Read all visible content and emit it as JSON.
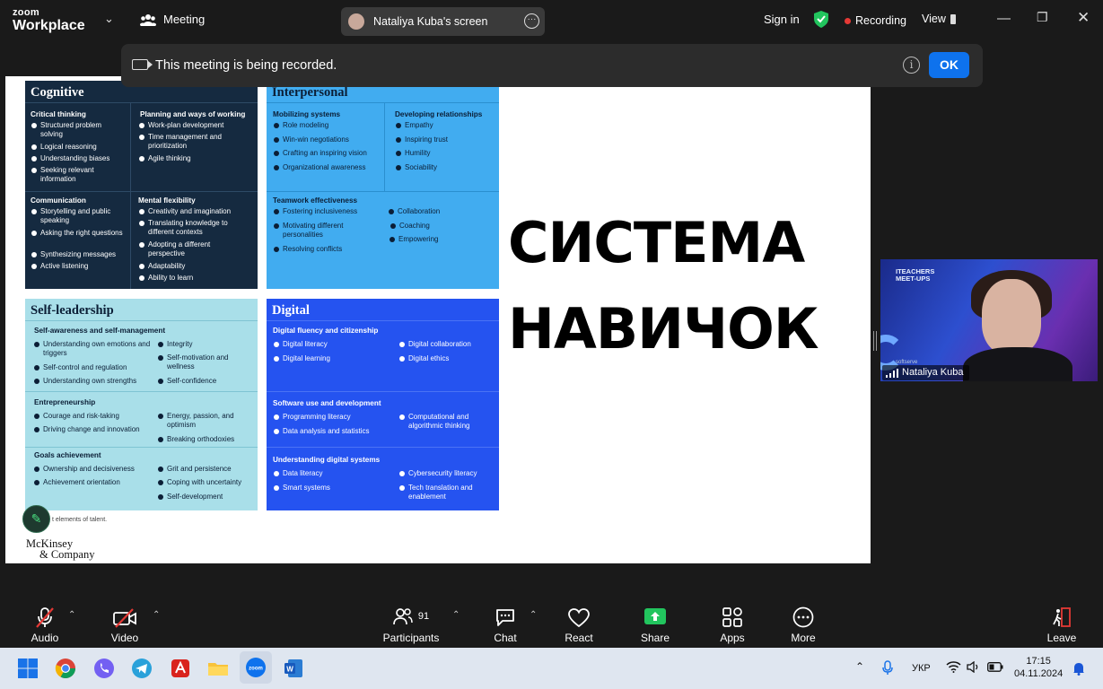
{
  "topbar": {
    "logo_line1": "zoom",
    "logo_line2": "Workplace",
    "meeting_label": "Meeting",
    "share_pill": "Nataliya Kuba's screen",
    "sign_in": "Sign in",
    "recording": "Recording",
    "view": "View"
  },
  "notice": {
    "text": "This meeting is being recorded.",
    "ok": "OK"
  },
  "slide": {
    "cognitive": {
      "title": "Cognitive",
      "critical_thinking": {
        "title": "Critical thinking",
        "items": [
          "Structured problem solving",
          "Logical reasoning",
          "Understanding biases",
          "Seeking relevant information"
        ]
      },
      "planning": {
        "title": "Planning and ways of working",
        "items": [
          "Work-plan development",
          "Time management and prioritization",
          "Agile thinking"
        ]
      },
      "communication": {
        "title": "Communication",
        "items": [
          "Storytelling and public speaking",
          "Asking the right questions",
          "Synthesizing messages",
          "Active listening"
        ]
      },
      "mental_flexibility": {
        "title": "Mental flexibility",
        "items": [
          "Creativity and imagination",
          "Translating knowledge to different contexts",
          "Adopting a different perspective",
          "Adaptability",
          "Ability to learn"
        ]
      }
    },
    "interpersonal": {
      "title": "Interpersonal",
      "mobilizing": {
        "title": "Mobilizing systems",
        "items": [
          "Role modeling",
          "Win-win negotiations",
          "Crafting an inspiring vision",
          "Organizational awareness"
        ]
      },
      "developing": {
        "title": "Developing relationships",
        "items": [
          "Empathy",
          "Inspiring trust",
          "Humility",
          "Sociability"
        ]
      },
      "teamwork": {
        "title": "Teamwork effectiveness",
        "items_left": [
          "Fostering inclusiveness",
          "Motivating different personalities",
          "Resolving conflicts"
        ],
        "items_right": [
          "Collaboration",
          "Coaching",
          "Empowering"
        ]
      }
    },
    "self_leadership": {
      "title": "Self-leadership",
      "awareness": {
        "title": "Self-awareness and self-management",
        "items_left": [
          "Understanding own emotions and triggers",
          "Self-control and regulation",
          "Understanding own strengths"
        ],
        "items_right": [
          "Integrity",
          "Self-motivation and wellness",
          "Self-confidence"
        ]
      },
      "entrepreneurship": {
        "title": "Entrepreneurship",
        "items_left": [
          "Courage and risk-taking",
          "Driving change and innovation"
        ],
        "items_right": [
          "Energy, passion, and optimism",
          "Breaking orthodoxies"
        ]
      },
      "goals": {
        "title": "Goals achievement",
        "items_left": [
          "Ownership and decisiveness",
          "Achievement orientation"
        ],
        "items_right": [
          "Grit and persistence",
          "Coping with uncertainty",
          "Self-development"
        ]
      }
    },
    "digital": {
      "title": "Digital",
      "fluency": {
        "title": "Digital fluency and citizenship",
        "items_left": [
          "Digital literacy",
          "Digital learning"
        ],
        "items_right": [
          "Digital collaboration",
          "Digital ethics"
        ]
      },
      "software": {
        "title": "Software use and development",
        "items_left": [
          "Programming literacy",
          "Data analysis and statistics"
        ],
        "items_right": [
          "Computational and algorithmic thinking"
        ]
      },
      "systems": {
        "title": "Understanding digital systems",
        "items_left": [
          "Data literacy",
          "Smart systems"
        ],
        "items_right": [
          "Cybersecurity literacy",
          "Tech translation and enablement"
        ]
      }
    },
    "big_line1": "СИСТЕМА",
    "big_line2": "НАВИЧОК",
    "footnote": "t elements of talent.",
    "brand_line1": "McKinsey",
    "brand_line2": "& Company"
  },
  "video": {
    "brand_line1": "ITEACHERS",
    "brand_line2": "MEET-UPS",
    "brand_small": "softserve",
    "participant_name": "Nataliya Kuba"
  },
  "controls": {
    "audio": "Audio",
    "video": "Video",
    "participants": "Participants",
    "participants_count": "91",
    "chat": "Chat",
    "react": "React",
    "share": "Share",
    "apps": "Apps",
    "more": "More",
    "leave": "Leave"
  },
  "taskbar": {
    "language": "УКР",
    "time": "17:15",
    "date": "04.11.2024"
  },
  "colors": {
    "zoom_blue": "#0e72ed",
    "share_green": "#22c55e",
    "leave_red": "#e53935",
    "cognitive_bg": "#152a40",
    "interpersonal_bg": "#41acf0",
    "self_leadership_bg": "#a9dfe9",
    "digital_bg": "#2553f0"
  }
}
